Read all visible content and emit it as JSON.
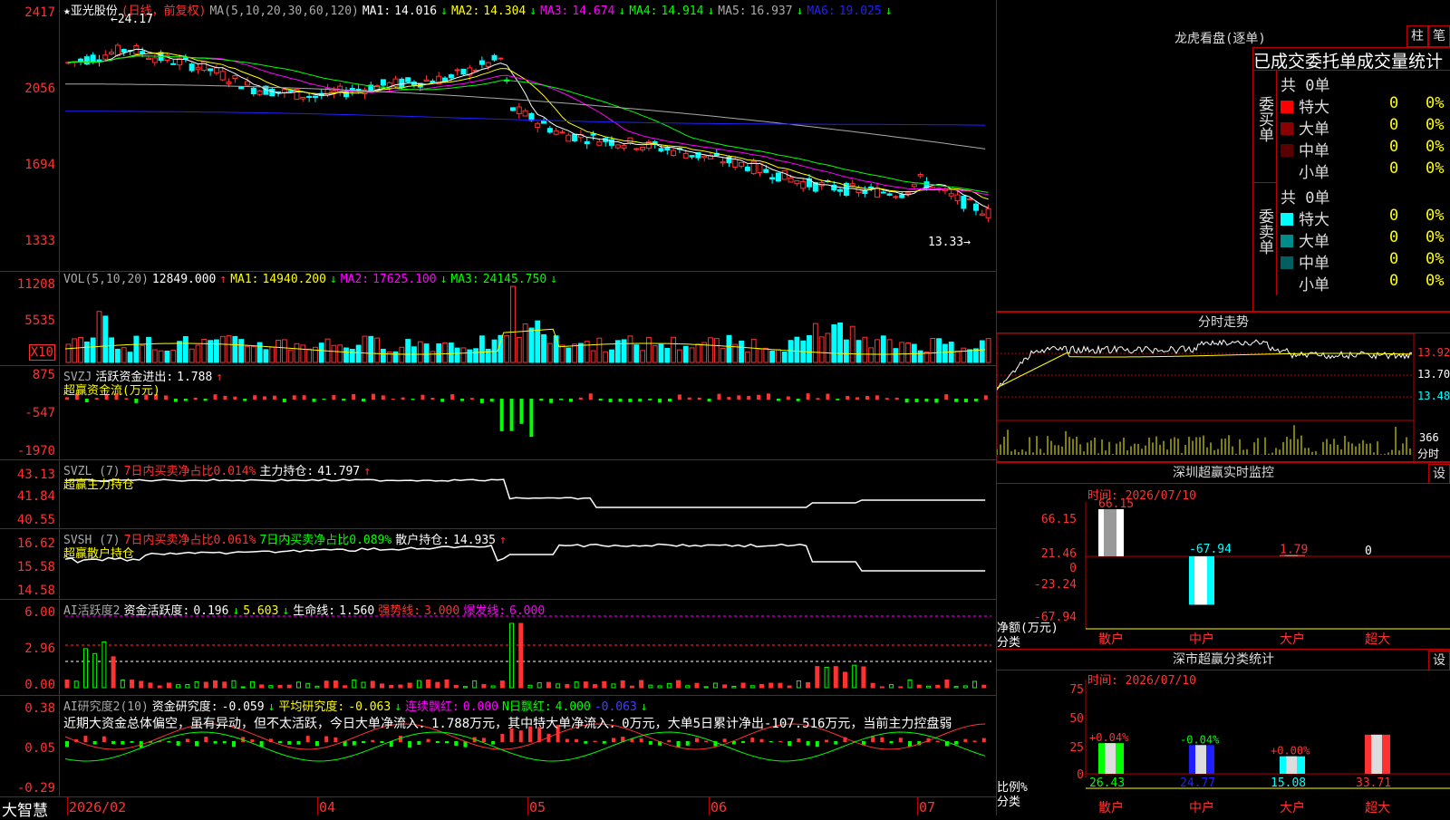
{
  "colors": {
    "up": "#ff3232",
    "down": "#00ffff",
    "ma1": "#ffffff",
    "ma2": "#ffff00",
    "ma3": "#ff00ff",
    "ma4": "#00ff00",
    "ma5": "#aaaaaa",
    "ma6": "#2020ff",
    "grid": "#bb0000"
  },
  "kline": {
    "stock": "★亚光股份",
    "mode": "(日线，前复权)",
    "ma_def": "MA(5,10,20,30,60,120)",
    "ma": [
      {
        "label": "MA1:",
        "value": "14.016",
        "arrow": "↓",
        "color": "#ffffff"
      },
      {
        "label": "MA2:",
        "value": "14.304",
        "arrow": "↓",
        "color": "#ffff00"
      },
      {
        "label": "MA3:",
        "value": "14.674",
        "arrow": "↓",
        "color": "#ff00ff"
      },
      {
        "label": "MA4:",
        "value": "14.914",
        "arrow": "↓",
        "color": "#00ff00"
      },
      {
        "label": "MA5:",
        "value": "16.937",
        "arrow": "↓",
        "color": "#aaaaaa"
      },
      {
        "label": "MA6:",
        "value": "19.025",
        "arrow": "↓",
        "color": "#2020ff"
      }
    ],
    "yaxis": [
      "2417",
      "2056",
      "1694",
      "1333"
    ],
    "high_label": "24.17",
    "low_label": "13.33"
  },
  "vol": {
    "title": "VOL(5,10,20)",
    "value": "12849.000",
    "arrow": "↑",
    "ma": [
      {
        "label": "MA1:",
        "value": "14940.200",
        "arrow": "↓",
        "color": "#ffff00"
      },
      {
        "label": "MA2:",
        "value": "17625.100",
        "arrow": "↓",
        "color": "#ff00ff"
      },
      {
        "label": "MA3:",
        "value": "24145.750",
        "arrow": "↓",
        "color": "#00ff00"
      }
    ],
    "yaxis": [
      "11208",
      "5535"
    ],
    "unit": "X10"
  },
  "svzj": {
    "title": "SVZJ",
    "l1": "活跃资金进出:",
    "v1": "1.788",
    "a1": "↑",
    "l2": "超赢资金流(万元)",
    "yaxis": [
      "875",
      "-547",
      "-1970"
    ]
  },
  "svzl": {
    "title": "SVZL (7)",
    "t1": "7日内买卖净占比0.014%",
    "l2": "主力持仓:",
    "v2": "41.797",
    "a2": "↑",
    "l3": "超赢主力持仓",
    "yaxis": [
      "43.13",
      "41.84",
      "40.55"
    ]
  },
  "svsh": {
    "title": "SVSH (7)",
    "t1": "7日内买卖净占比0.061%",
    "t2": "7日内买卖净占比0.089%",
    "l3": "散户持仓:",
    "v3": "14.935",
    "a3": "↑",
    "l4": "超赢散户持仓",
    "yaxis": [
      "16.62",
      "15.58",
      "14.58"
    ]
  },
  "ai1": {
    "title": "AI活跃度2",
    "l1": "资金活跃度:",
    "v1": "0.196",
    "a1": "↓",
    "v2": "5.603",
    "a2": "↓",
    "l3": "生命线:",
    "v3": "1.560",
    "l4": "强势线:",
    "v4": "3.000",
    "l5": "爆发线:",
    "v5": "6.000",
    "yaxis": [
      "6.00",
      "2.96",
      "0.00"
    ]
  },
  "ai2": {
    "title": "AI研究度2(10)",
    "l1": "资金研究度:",
    "v1": "-0.059",
    "a1": "↓",
    "l2": "平均研究度:",
    "v2": "-0.063",
    "a2": "↓",
    "l3": "连续飘红:",
    "v3": "0.000",
    "l4": "N日飘红:",
    "v4": "4.000",
    "v5": "-0.063",
    "a5": "↓",
    "comment": "近期大资金总体偏空，虽有异动，但不太活跃，今日大单净流入：1.788万元，其中特大单净流入：0万元，大单5日累计净出-107.516万元，当前主力控盘弱",
    "yaxis": [
      "0.38",
      "0.05",
      "-0.29"
    ]
  },
  "xaxis": {
    "brand": "大智慧",
    "ticks": [
      "2026/02",
      "04",
      "05",
      "06",
      "07"
    ]
  },
  "longhu": {
    "title": "龙虎看盘(逐单)",
    "btn1": "柱",
    "btn2": "笔",
    "tabs": [
      "已成交",
      "委托单",
      "成交量统计"
    ],
    "buy": {
      "side": "委买单",
      "total": "共 0单",
      "rows": [
        {
          "label": "特大",
          "count": "0",
          "pct": "0%",
          "color": "#ff0000"
        },
        {
          "label": "大单",
          "count": "0",
          "pct": "0%",
          "color": "#8b0000"
        },
        {
          "label": "中单",
          "count": "0",
          "pct": "0%",
          "color": "#5a0000"
        },
        {
          "label": "小单",
          "count": "0",
          "pct": "0%",
          "color": ""
        }
      ]
    },
    "sell": {
      "side": "委卖单",
      "total": "共 0单",
      "rows": [
        {
          "label": "特大",
          "count": "0",
          "pct": "0%",
          "color": "#00ffff"
        },
        {
          "label": "大单",
          "count": "0",
          "pct": "0%",
          "color": "#008b8b"
        },
        {
          "label": "中单",
          "count": "0",
          "pct": "0%",
          "color": "#006060"
        },
        {
          "label": "小单",
          "count": "0",
          "pct": "0%",
          "color": ""
        }
      ]
    }
  },
  "fenshi": {
    "title": "分时走势",
    "y1": "13.92",
    "y2": "13.70",
    "y3": "13.48",
    "vol": "366",
    "vol_label": "分时"
  },
  "monitor": {
    "title": "深圳超赢实时监控",
    "btn": "设",
    "time": "时间: 2026/07/10",
    "yaxis": [
      "66.15",
      "21.46",
      "0",
      "-23.24",
      "-67.94"
    ],
    "ylabel1": "净额(万元)",
    "ylabel2": "分类",
    "bars": [
      {
        "label": "散户",
        "value": 66.15,
        "vlabel": "66.15"
      },
      {
        "label": "中户",
        "value": -67.94,
        "vlabel": "-67.94"
      },
      {
        "label": "大户",
        "value": 1.79,
        "vlabel": "1.79"
      },
      {
        "label": "超大",
        "value": 0,
        "vlabel": "0"
      }
    ]
  },
  "classify": {
    "title": "深市超赢分类统计",
    "btn": "设",
    "time": "时间: 2026/07/10",
    "yaxis": [
      "75",
      "50",
      "25",
      "0"
    ],
    "ylabel1": "比例%",
    "ylabel2": "分类",
    "bars": [
      {
        "label": "散户",
        "value": 26.43,
        "vlabel": "26.43",
        "chg": "+0.04%",
        "color": "#00ff00"
      },
      {
        "label": "中户",
        "value": 24.77,
        "vlabel": "24.77",
        "chg": "-0.04%",
        "color": "#2020ff"
      },
      {
        "label": "大户",
        "value": 15.08,
        "vlabel": "15.08",
        "chg": "+0.00%",
        "color": "#00ffff"
      },
      {
        "label": "超大",
        "value": 33.71,
        "vlabel": "33.71",
        "chg": "",
        "color": "#ff3232"
      }
    ]
  }
}
